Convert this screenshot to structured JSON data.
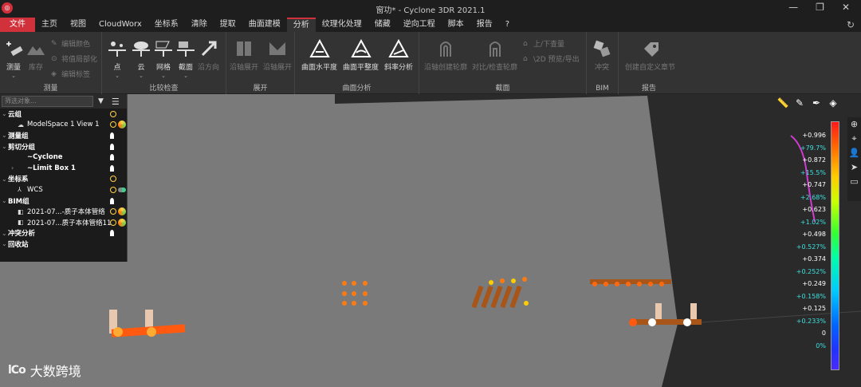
{
  "window": {
    "title": "窗功* - Cyclone 3DR 2021.1",
    "app_icon": "cyclone-logo-icon",
    "controls": [
      "—",
      "❐",
      "✕"
    ]
  },
  "menu": {
    "items": [
      "文件",
      "主页",
      "视图",
      "CloudWorx",
      "坐标系",
      "清除",
      "提取",
      "曲面建模",
      "分析",
      "纹理化处理",
      "储藏",
      "逆向工程",
      "脚本",
      "报告",
      "?"
    ],
    "active_index": 8
  },
  "ribbon": {
    "measure": {
      "label": "测量",
      "measure_btn": "测量",
      "library_btn": "库存",
      "edit_color": "编辑颜色",
      "reset_labels": "将值局部化",
      "edit_tags": "编辑标签"
    },
    "compare": {
      "label": "比较检查",
      "point": "点",
      "cloud": "云",
      "mesh": "网格",
      "section": "截面",
      "along_direction": "沿方向"
    },
    "unfold": {
      "label": "展开",
      "along_unfold": "沿轴展开",
      "along_unfold2": "沿轴展开"
    },
    "surface": {
      "label": "曲面分析",
      "flatness": "曲面水平度",
      "planarity": "曲面平整度",
      "slope": "斜率分析"
    },
    "section": {
      "label": "截面",
      "create_profile": "沿轴创建轮廓",
      "compare_profile": "对比/检查轮廓",
      "up_down": "上/下查量",
      "to2d": "\\2D 预览/导出"
    },
    "bim": {
      "label": "BIM",
      "clash": "冲突"
    },
    "report": {
      "label": "报告",
      "create_chapter": "创建自定义章节"
    }
  },
  "tree": {
    "search_placeholder": "筛选对象...",
    "rows": [
      {
        "indent": 0,
        "label": "云组",
        "bold": true
      },
      {
        "indent": 1,
        "label": "ModelSpace 1 View 1",
        "bold": false
      },
      {
        "indent": 0,
        "label": "测量组",
        "bold": true
      },
      {
        "indent": 0,
        "label": "剪切分组",
        "bold": true
      },
      {
        "indent": 1,
        "label": "~Cyclone",
        "bold": true
      },
      {
        "indent": 1,
        "label": "~Limit Box 1",
        "bold": true
      },
      {
        "indent": 0,
        "label": "坐标系",
        "bold": true
      },
      {
        "indent": 1,
        "label": "WCS",
        "bold": false
      },
      {
        "indent": 0,
        "label": "BIM组",
        "bold": true
      },
      {
        "indent": 1,
        "label": "2021-07...-质子本体管络",
        "bold": false
      },
      {
        "indent": 1,
        "label": "2021-07...质子本体管络11",
        "bold": false
      },
      {
        "indent": 0,
        "label": "冲突分析",
        "bold": true
      },
      {
        "indent": 0,
        "label": "回收站",
        "bold": true
      }
    ]
  },
  "scale": {
    "labels": [
      {
        "text": "+0.996",
        "kind": "w"
      },
      {
        "text": "+79.7%",
        "kind": "c"
      },
      {
        "text": "+0.872",
        "kind": "w"
      },
      {
        "text": "+15.5%",
        "kind": "c"
      },
      {
        "text": "+0.747",
        "kind": "w"
      },
      {
        "text": "+2.68%",
        "kind": "c"
      },
      {
        "text": "+0.623",
        "kind": "w"
      },
      {
        "text": "+1.02%",
        "kind": "c"
      },
      {
        "text": "+0.498",
        "kind": "w"
      },
      {
        "text": "+0.527%",
        "kind": "c"
      },
      {
        "text": "+0.374",
        "kind": "w"
      },
      {
        "text": "+0.252%",
        "kind": "c"
      },
      {
        "text": "+0.249",
        "kind": "w"
      },
      {
        "text": "+0.158%",
        "kind": "c"
      },
      {
        "text": "+0.125",
        "kind": "w"
      },
      {
        "text": "+0.233%",
        "kind": "c"
      },
      {
        "text": "0",
        "kind": "w"
      },
      {
        "text": "0%",
        "kind": "c"
      }
    ]
  },
  "watermark": {
    "logo": "lCo",
    "text": "大数跨境"
  }
}
